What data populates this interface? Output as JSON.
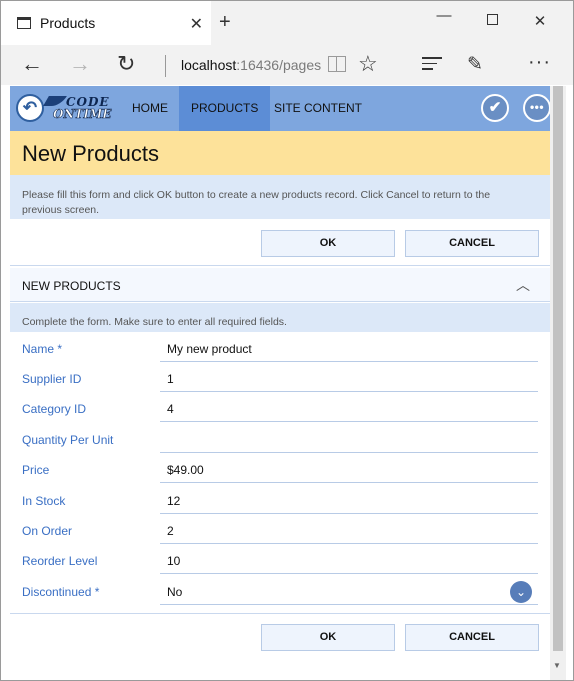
{
  "browser": {
    "tab_title": "Products",
    "tab_close": "✕",
    "new_tab": "+",
    "minimize": "—",
    "close": "✕",
    "back": "←",
    "forward": "→",
    "refresh": "↻",
    "address_host": "localhost",
    "address_rest": ":16436/pages",
    "favorite": "☆",
    "note": "✎",
    "more": "···"
  },
  "app": {
    "logo_line1": "CODE",
    "logo_line2": "ONTIME",
    "back_glyph": "↶",
    "menu": [
      {
        "label": "HOME"
      },
      {
        "label": "PRODUCTS"
      },
      {
        "label": "SITE CONTENT"
      }
    ],
    "check_glyph": "✔",
    "more_glyph": "•••"
  },
  "page": {
    "title": "New Products",
    "instructions": "Please fill this form and click OK button to create a new products record. Click Cancel to return to the previous screen.",
    "ok_label": "OK",
    "cancel_label": "CANCEL"
  },
  "category": {
    "title": "NEW PRODUCTS",
    "collapse_glyph": "︿",
    "description": "Complete the form. Make sure to enter all required fields."
  },
  "fields": [
    {
      "label": "Name *",
      "value": "My new product"
    },
    {
      "label": "Supplier ID",
      "value": "1"
    },
    {
      "label": "Category ID",
      "value": "4"
    },
    {
      "label": "Quantity Per Unit",
      "value": ""
    },
    {
      "label": "Price",
      "value": "$49.00"
    },
    {
      "label": "In Stock",
      "value": "12"
    },
    {
      "label": "On Order",
      "value": "2"
    },
    {
      "label": "Reorder Level",
      "value": "10"
    },
    {
      "label": "Discontinued *",
      "value": "No"
    }
  ],
  "dropdown_glyph": "⌄"
}
